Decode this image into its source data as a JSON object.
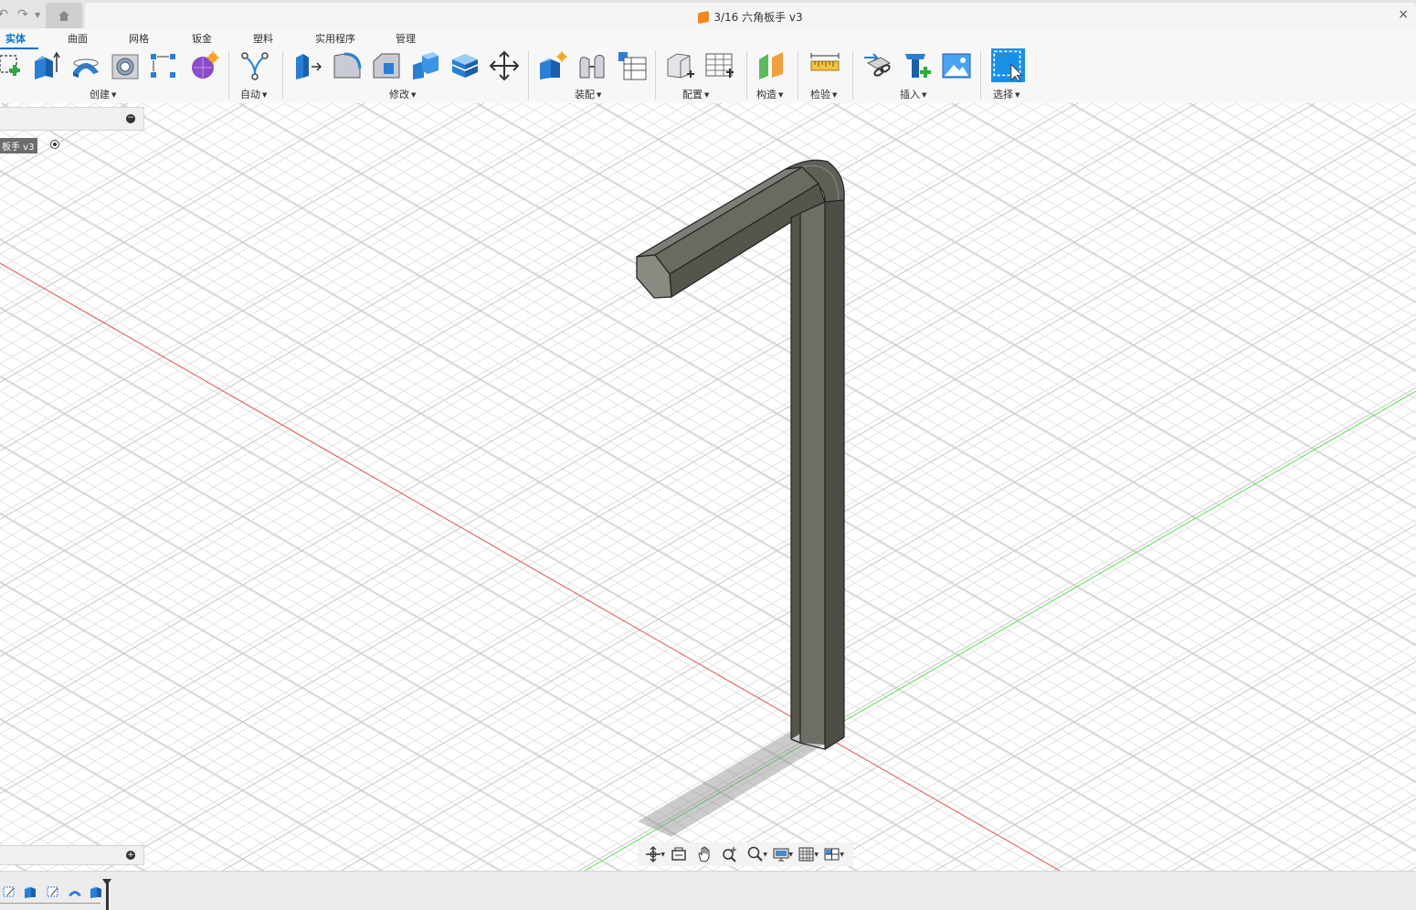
{
  "title_bar": {
    "document_title": "3/16 六角板手 v3",
    "icons": [
      "undo-icon",
      "redo-icon",
      "home-icon",
      "close-icon"
    ],
    "close_glyph": "×"
  },
  "ribbon": {
    "tabs": [
      "实体",
      "曲面",
      "网格",
      "钣金",
      "塑料",
      "实用程序",
      "管理"
    ],
    "active_tab": "实体",
    "groups": [
      {
        "label": "创建",
        "tools": [
          "create-sketch-icon",
          "extrude-icon",
          "revolve-icon",
          "hole-icon",
          "pattern-icon",
          "create-form-icon"
        ]
      },
      {
        "label": "自动",
        "tools": [
          "automated-modeling-icon"
        ]
      },
      {
        "label": "修改",
        "tools": [
          "press-pull-icon",
          "fillet-icon",
          "chamfer-icon",
          "combine-icon",
          "shell-icon",
          "move-icon"
        ]
      },
      {
        "label": "装配",
        "tools": [
          "new-component-icon",
          "joint-icon",
          "table-icon"
        ]
      },
      {
        "label": "配置",
        "tools": [
          "configure-icon",
          "configure-table-icon"
        ]
      },
      {
        "label": "构造",
        "tools": [
          "offset-plane-icon"
        ]
      },
      {
        "label": "检验",
        "tools": [
          "measure-icon"
        ]
      },
      {
        "label": "插入",
        "tools": [
          "insert-derive-icon",
          "insert-mesh-icon",
          "insert-canvas-icon"
        ]
      },
      {
        "label": "选择",
        "tools": [
          "select-icon"
        ]
      }
    ]
  },
  "browser": {
    "component_label": "板手 v3",
    "collapse_glyph": "−",
    "comments_expand_glyph": "+"
  },
  "viewport": {
    "background": "#ffffff",
    "grid_color": "#d8d8d8",
    "x_axis_color": "#e05050",
    "y_axis_color": "#5bd95b",
    "model_color": "#6a6a62"
  },
  "navbar": {
    "tools": [
      "orbit-icon",
      "look-at-icon",
      "pan-icon",
      "zoom-icon",
      "fit-icon",
      "display-settings-icon",
      "grid-settings-icon",
      "viewports-icon"
    ]
  },
  "timeline": {
    "items": [
      "sketch-feature-icon",
      "extrude-feature-icon",
      "sketch-feature-icon",
      "sweep-feature-icon",
      "extrude-feature-icon"
    ]
  }
}
